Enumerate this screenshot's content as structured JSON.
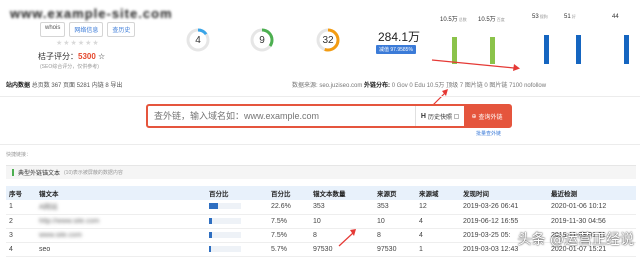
{
  "header": {
    "site_name": "www.example-site.com",
    "tags": [
      "whois",
      "网络信息",
      "查历史"
    ],
    "stars": "★★★★★★",
    "score_label": "桔子评分：",
    "score_value": "5300",
    "score_sub": "(SEO综合评分，仅供参考)"
  },
  "gauges": [
    {
      "value": "4",
      "color": "#3aa5e8",
      "fraction": 0.15
    },
    {
      "value": "9",
      "color": "#4caf50",
      "fraction": 0.35
    },
    {
      "value": "32",
      "color": "#f39c12",
      "fraction": 0.55
    }
  ],
  "big_stat": {
    "value": "284.1万",
    "badge": "减值 97.9585%"
  },
  "bars": [
    {
      "label": "10.5万",
      "sub": "总数",
      "color": "#8bc34a",
      "fraction": 0.8
    },
    {
      "label": "10.5万",
      "sub": "百度",
      "color": "#8bc34a",
      "fraction": 0.8
    },
    {
      "label": "53",
      "sub": "搜狗",
      "color": "#1565c0",
      "fraction": 0.85
    },
    {
      "label": "51",
      "sub": "好",
      "color": "#1565c0",
      "fraction": 0.85
    },
    {
      "label": "44",
      "sub": "",
      "color": "#1565c0",
      "fraction": 0.85
    }
  ],
  "stats": {
    "site_data_label": "站内数据",
    "site_data_text": "总页数 367 页面  5281 内链  8 导出",
    "source_text": "数据来源: seo.juziseo.com",
    "ext_label": "外链分布:",
    "ext_items": "0 Gov  0 Edu  10.5万 顶级  7 图片链  0 图片链  7100 nofollow"
  },
  "search": {
    "placeholder": "查外链，输入域名如：www.example.com",
    "history_label": "历史快照",
    "button_label": "查询外链",
    "batch_link": "批量查外链"
  },
  "quick_label": "快捷链接：",
  "panel": {
    "title": "典型外链锚文本",
    "note": "(10)表示被屏蔽的数据内容"
  },
  "table": {
    "headers": [
      "序号",
      "锚文本",
      "百分比",
      "百分比",
      "锚文本数量",
      "来源页",
      "来源域",
      "发现时间",
      "最近检测"
    ],
    "rows": [
      {
        "idx": "1",
        "anchor": "A网站",
        "pct_fill": 0.226,
        "pct": "22.6%",
        "count": "353",
        "pages": "353",
        "domains": "12",
        "found": "2019-03-26 06:41",
        "checked": "2020-01-06 10:12"
      },
      {
        "idx": "2",
        "anchor": "http://www.site.com",
        "pct_fill": 0.075,
        "pct": "7.5%",
        "count": "10",
        "pages": "10",
        "domains": "4",
        "found": "2019-06-12 16:55",
        "checked": "2019-11-30 04:56"
      },
      {
        "idx": "3",
        "anchor": "www.site.com",
        "pct_fill": 0.075,
        "pct": "7.5%",
        "count": "8",
        "pages": "8",
        "domains": "4",
        "found": "2019-03-25 05:",
        "checked": "2019-11-03 01:21"
      },
      {
        "idx": "4",
        "anchor": "seo",
        "pct_fill": 0.057,
        "pct": "5.7%",
        "count": "97530",
        "pages": "97530",
        "domains": "1",
        "found": "2019-03-03 12:43",
        "checked": "2020-01-07 15:21"
      }
    ]
  },
  "watermark": "头条 @运营正经说"
}
